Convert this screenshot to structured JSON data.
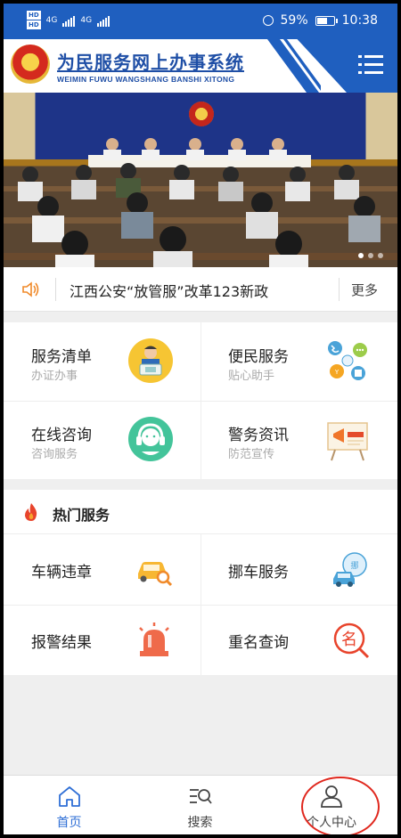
{
  "status_bar": {
    "hd_top": "HD",
    "hd_bottom": "HD",
    "net1": "4G",
    "net2": "4G",
    "battery": "59%",
    "time": "10:38"
  },
  "header": {
    "title": "为民服务网上办事系统",
    "subtitle": "WEIMIN FUWU WANGSHANG BANSHI XITONG"
  },
  "banner": {
    "slides": 3,
    "active_slide": 1
  },
  "news": {
    "text": "江西公安“放管服”改革123新政",
    "more": "更多"
  },
  "services": [
    {
      "title": "服务清单",
      "subtitle": "办证办事",
      "icon": "clerk-icon"
    },
    {
      "title": "便民服务",
      "subtitle": "贴心助手",
      "icon": "convenience-services-icon"
    },
    {
      "title": "在线咨询",
      "subtitle": "咨询服务",
      "icon": "headset-agent-icon"
    },
    {
      "title": "警务资讯",
      "subtitle": "防范宣传",
      "icon": "megaphone-board-icon"
    }
  ],
  "hot": {
    "title": "热门服务",
    "items": [
      {
        "label": "车辆违章",
        "icon": "car-search-icon"
      },
      {
        "label": "挪车服务",
        "icon": "car-move-icon"
      },
      {
        "label": "报警结果",
        "icon": "siren-icon"
      },
      {
        "label": "重名查询",
        "icon": "name-search-icon"
      }
    ]
  },
  "nav": [
    {
      "label": "首页",
      "icon": "home-icon",
      "active": true
    },
    {
      "label": "搜索",
      "icon": "search-icon",
      "active": false
    },
    {
      "label": "个人中心",
      "icon": "user-icon",
      "active": false
    }
  ],
  "colors": {
    "brand_blue": "#1f5fbf",
    "active_tab": "#2f6fd6",
    "annotation_red": "#e0281e"
  }
}
